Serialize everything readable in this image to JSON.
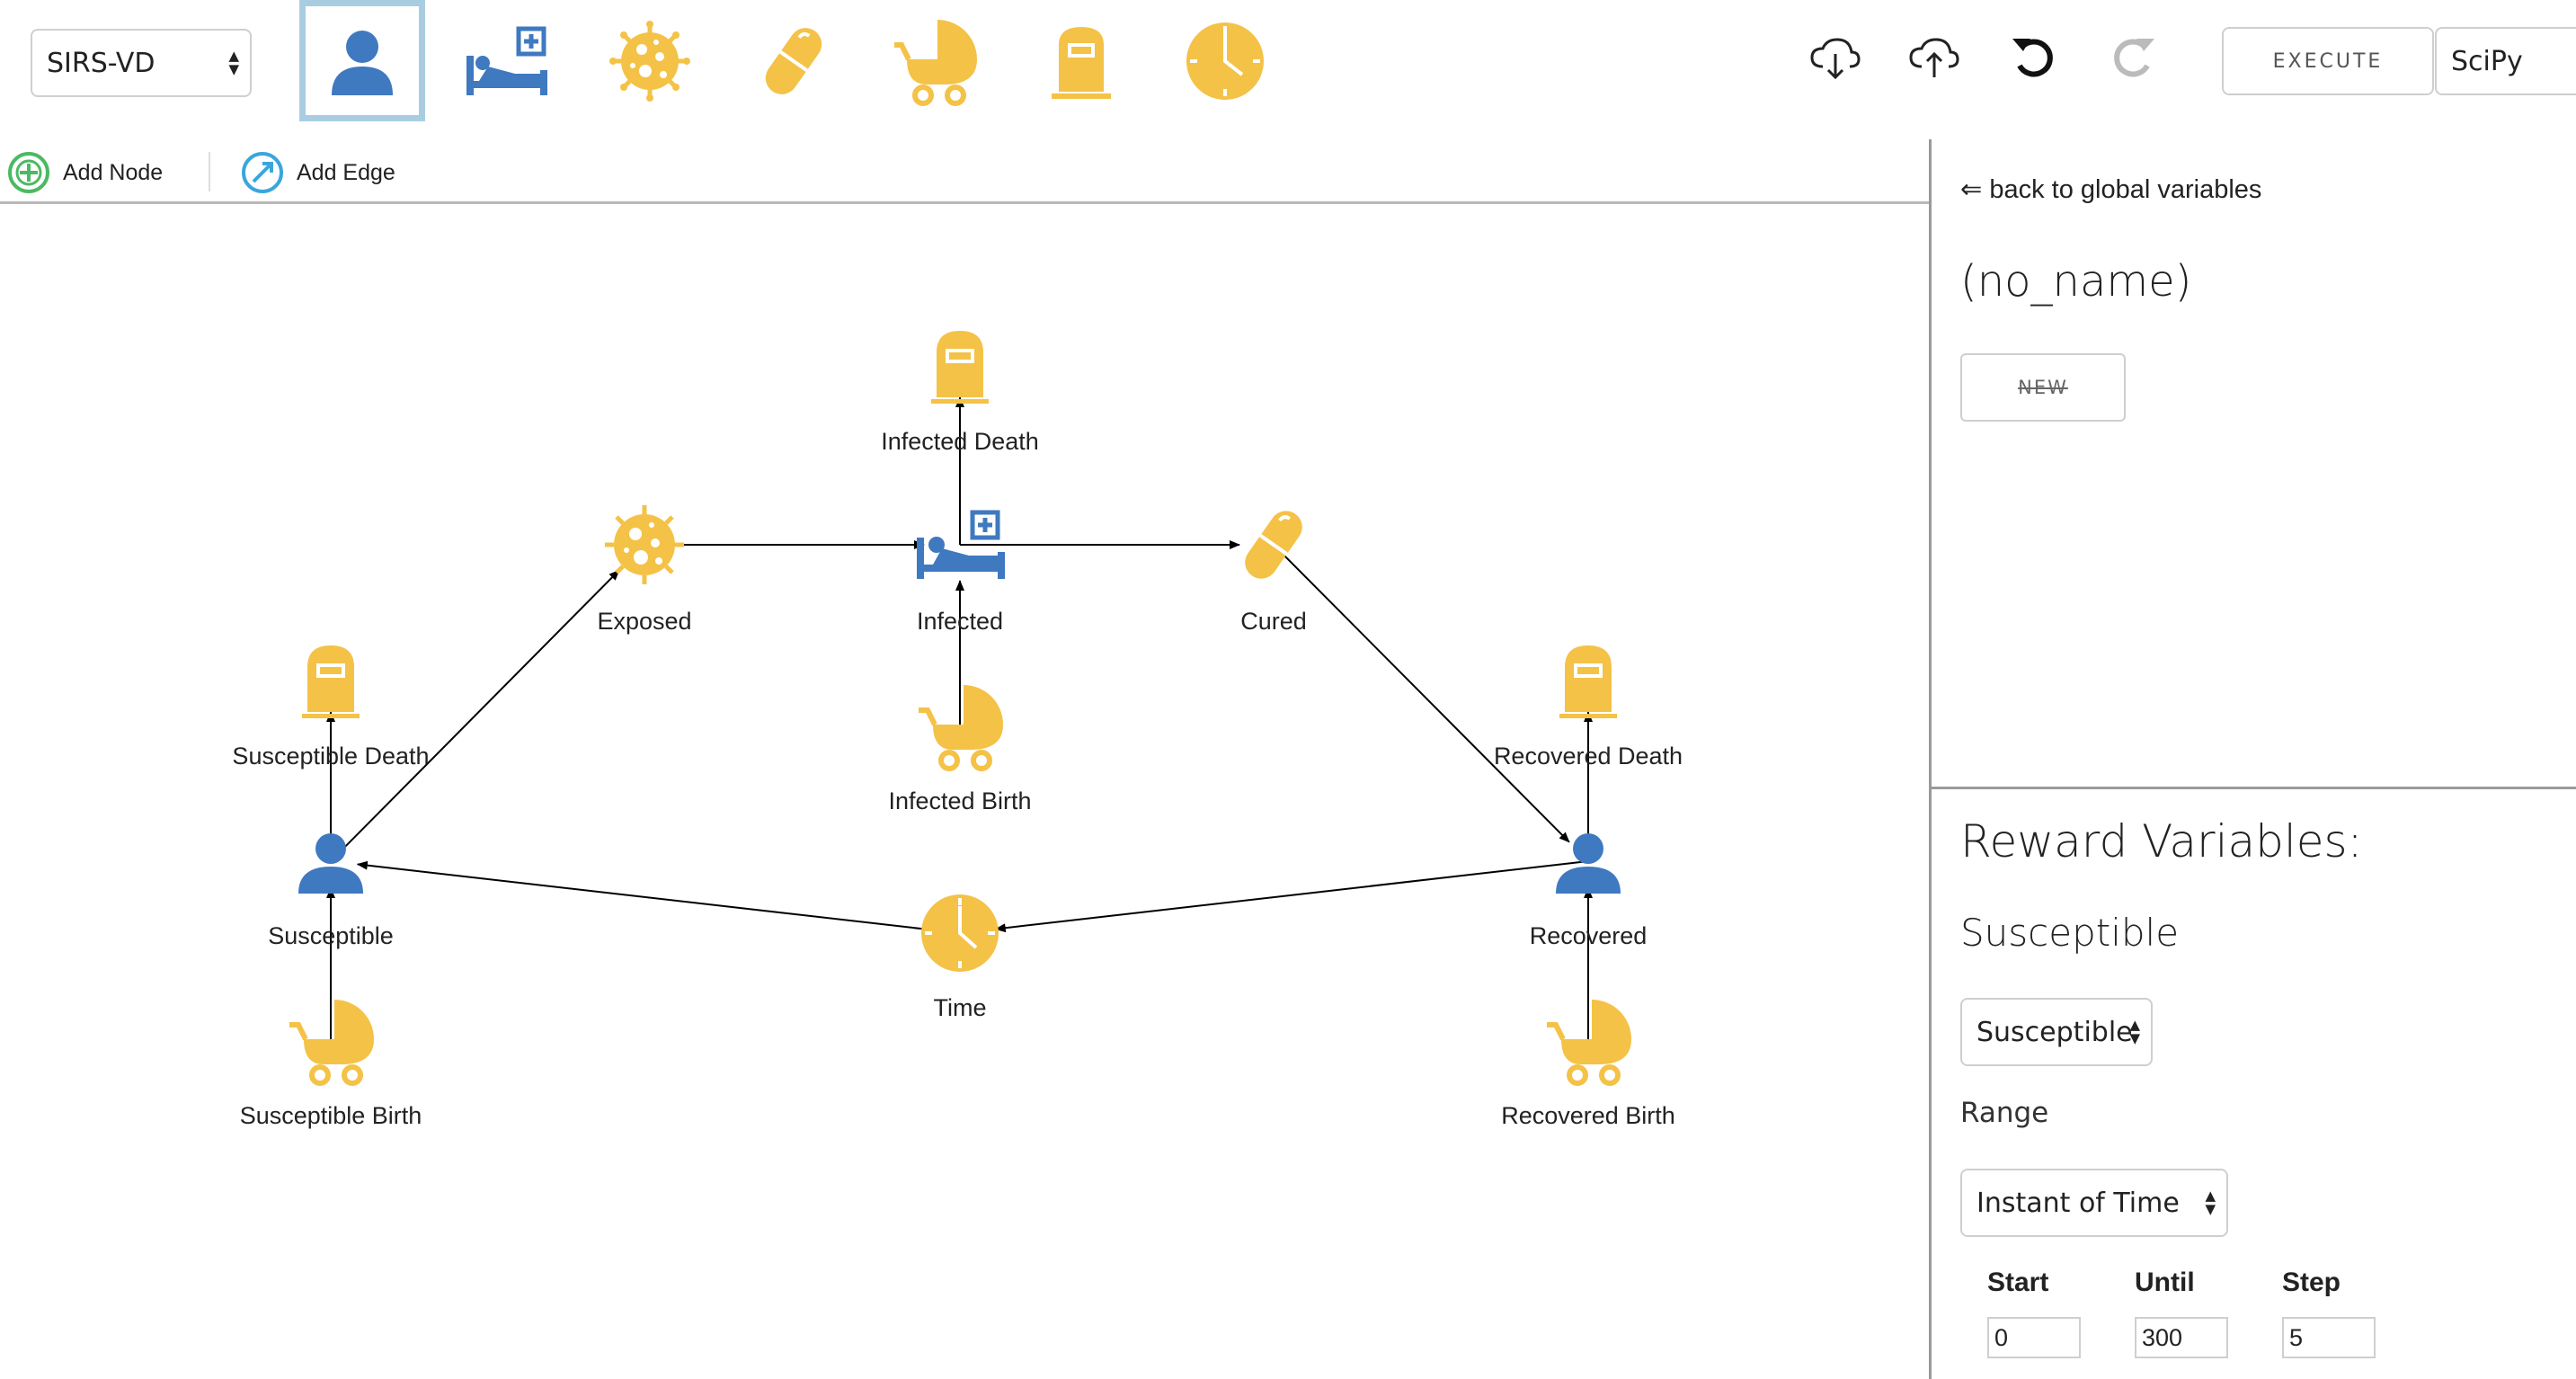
{
  "toolbar": {
    "model_select": "SIRS-VD",
    "palette": [
      {
        "name": "person",
        "selected": true
      },
      {
        "name": "hospital-bed",
        "selected": false
      },
      {
        "name": "virus",
        "selected": false
      },
      {
        "name": "pill",
        "selected": false
      },
      {
        "name": "baby-carriage",
        "selected": false
      },
      {
        "name": "tombstone",
        "selected": false
      },
      {
        "name": "clock",
        "selected": false
      }
    ],
    "tools": [
      "cloud-download-icon",
      "cloud-upload-icon",
      "undo-icon",
      "redo-icon"
    ],
    "execute_label": "EXECUTE",
    "engine_select": "SciPy"
  },
  "subbar": {
    "add_node_label": "Add Node",
    "add_edge_label": "Add Edge"
  },
  "graph": {
    "nodes": [
      {
        "id": "infected-death",
        "label": "Infected Death",
        "icon": "tombstone"
      },
      {
        "id": "exposed",
        "label": "Exposed",
        "icon": "virus"
      },
      {
        "id": "infected",
        "label": "Infected",
        "icon": "hospital-bed"
      },
      {
        "id": "cured",
        "label": "Cured",
        "icon": "pill"
      },
      {
        "id": "susceptible-death",
        "label": "Susceptible Death",
        "icon": "tombstone"
      },
      {
        "id": "infected-birth",
        "label": "Infected Birth",
        "icon": "baby-carriage"
      },
      {
        "id": "recovered-death",
        "label": "Recovered Death",
        "icon": "tombstone"
      },
      {
        "id": "susceptible",
        "label": "Susceptible",
        "icon": "person"
      },
      {
        "id": "recovered",
        "label": "Recovered",
        "icon": "person"
      },
      {
        "id": "time",
        "label": "Time",
        "icon": "clock"
      },
      {
        "id": "susceptible-birth",
        "label": "Susceptible Birth",
        "icon": "baby-carriage"
      },
      {
        "id": "recovered-birth",
        "label": "Recovered Birth",
        "icon": "baby-carriage"
      }
    ],
    "edges": [
      [
        "susceptible",
        "exposed"
      ],
      [
        "exposed",
        "infected"
      ],
      [
        "infected",
        "cured"
      ],
      [
        "cured",
        "recovered"
      ],
      [
        "infected",
        "infected-death"
      ],
      [
        "infected-birth",
        "infected"
      ],
      [
        "susceptible",
        "susceptible-death"
      ],
      [
        "susceptible-birth",
        "susceptible"
      ],
      [
        "recovered",
        "recovered-death"
      ],
      [
        "recovered-birth",
        "recovered"
      ],
      [
        "recovered",
        "time"
      ],
      [
        "time",
        "susceptible"
      ]
    ]
  },
  "panel": {
    "back_link": "⇐ back to global variables",
    "variable_name": "(no_name)",
    "new_button": "NEW",
    "reward_title": "Reward Variables:",
    "reward_subtitle": "Susceptible",
    "reward_select": "Susceptible",
    "range_label": "Range",
    "range_select": "Instant of Time",
    "start_label": "Start",
    "until_label": "Until",
    "step_label": "Step",
    "start_value": "0",
    "until_value": "300",
    "step_value": "5"
  },
  "colors": {
    "yellow": "#F4C247",
    "blue": "#3F79C0",
    "selected_border": "#A9CDE0",
    "add_node_green": "#4CB963",
    "add_edge_blue": "#3AA6DD"
  }
}
